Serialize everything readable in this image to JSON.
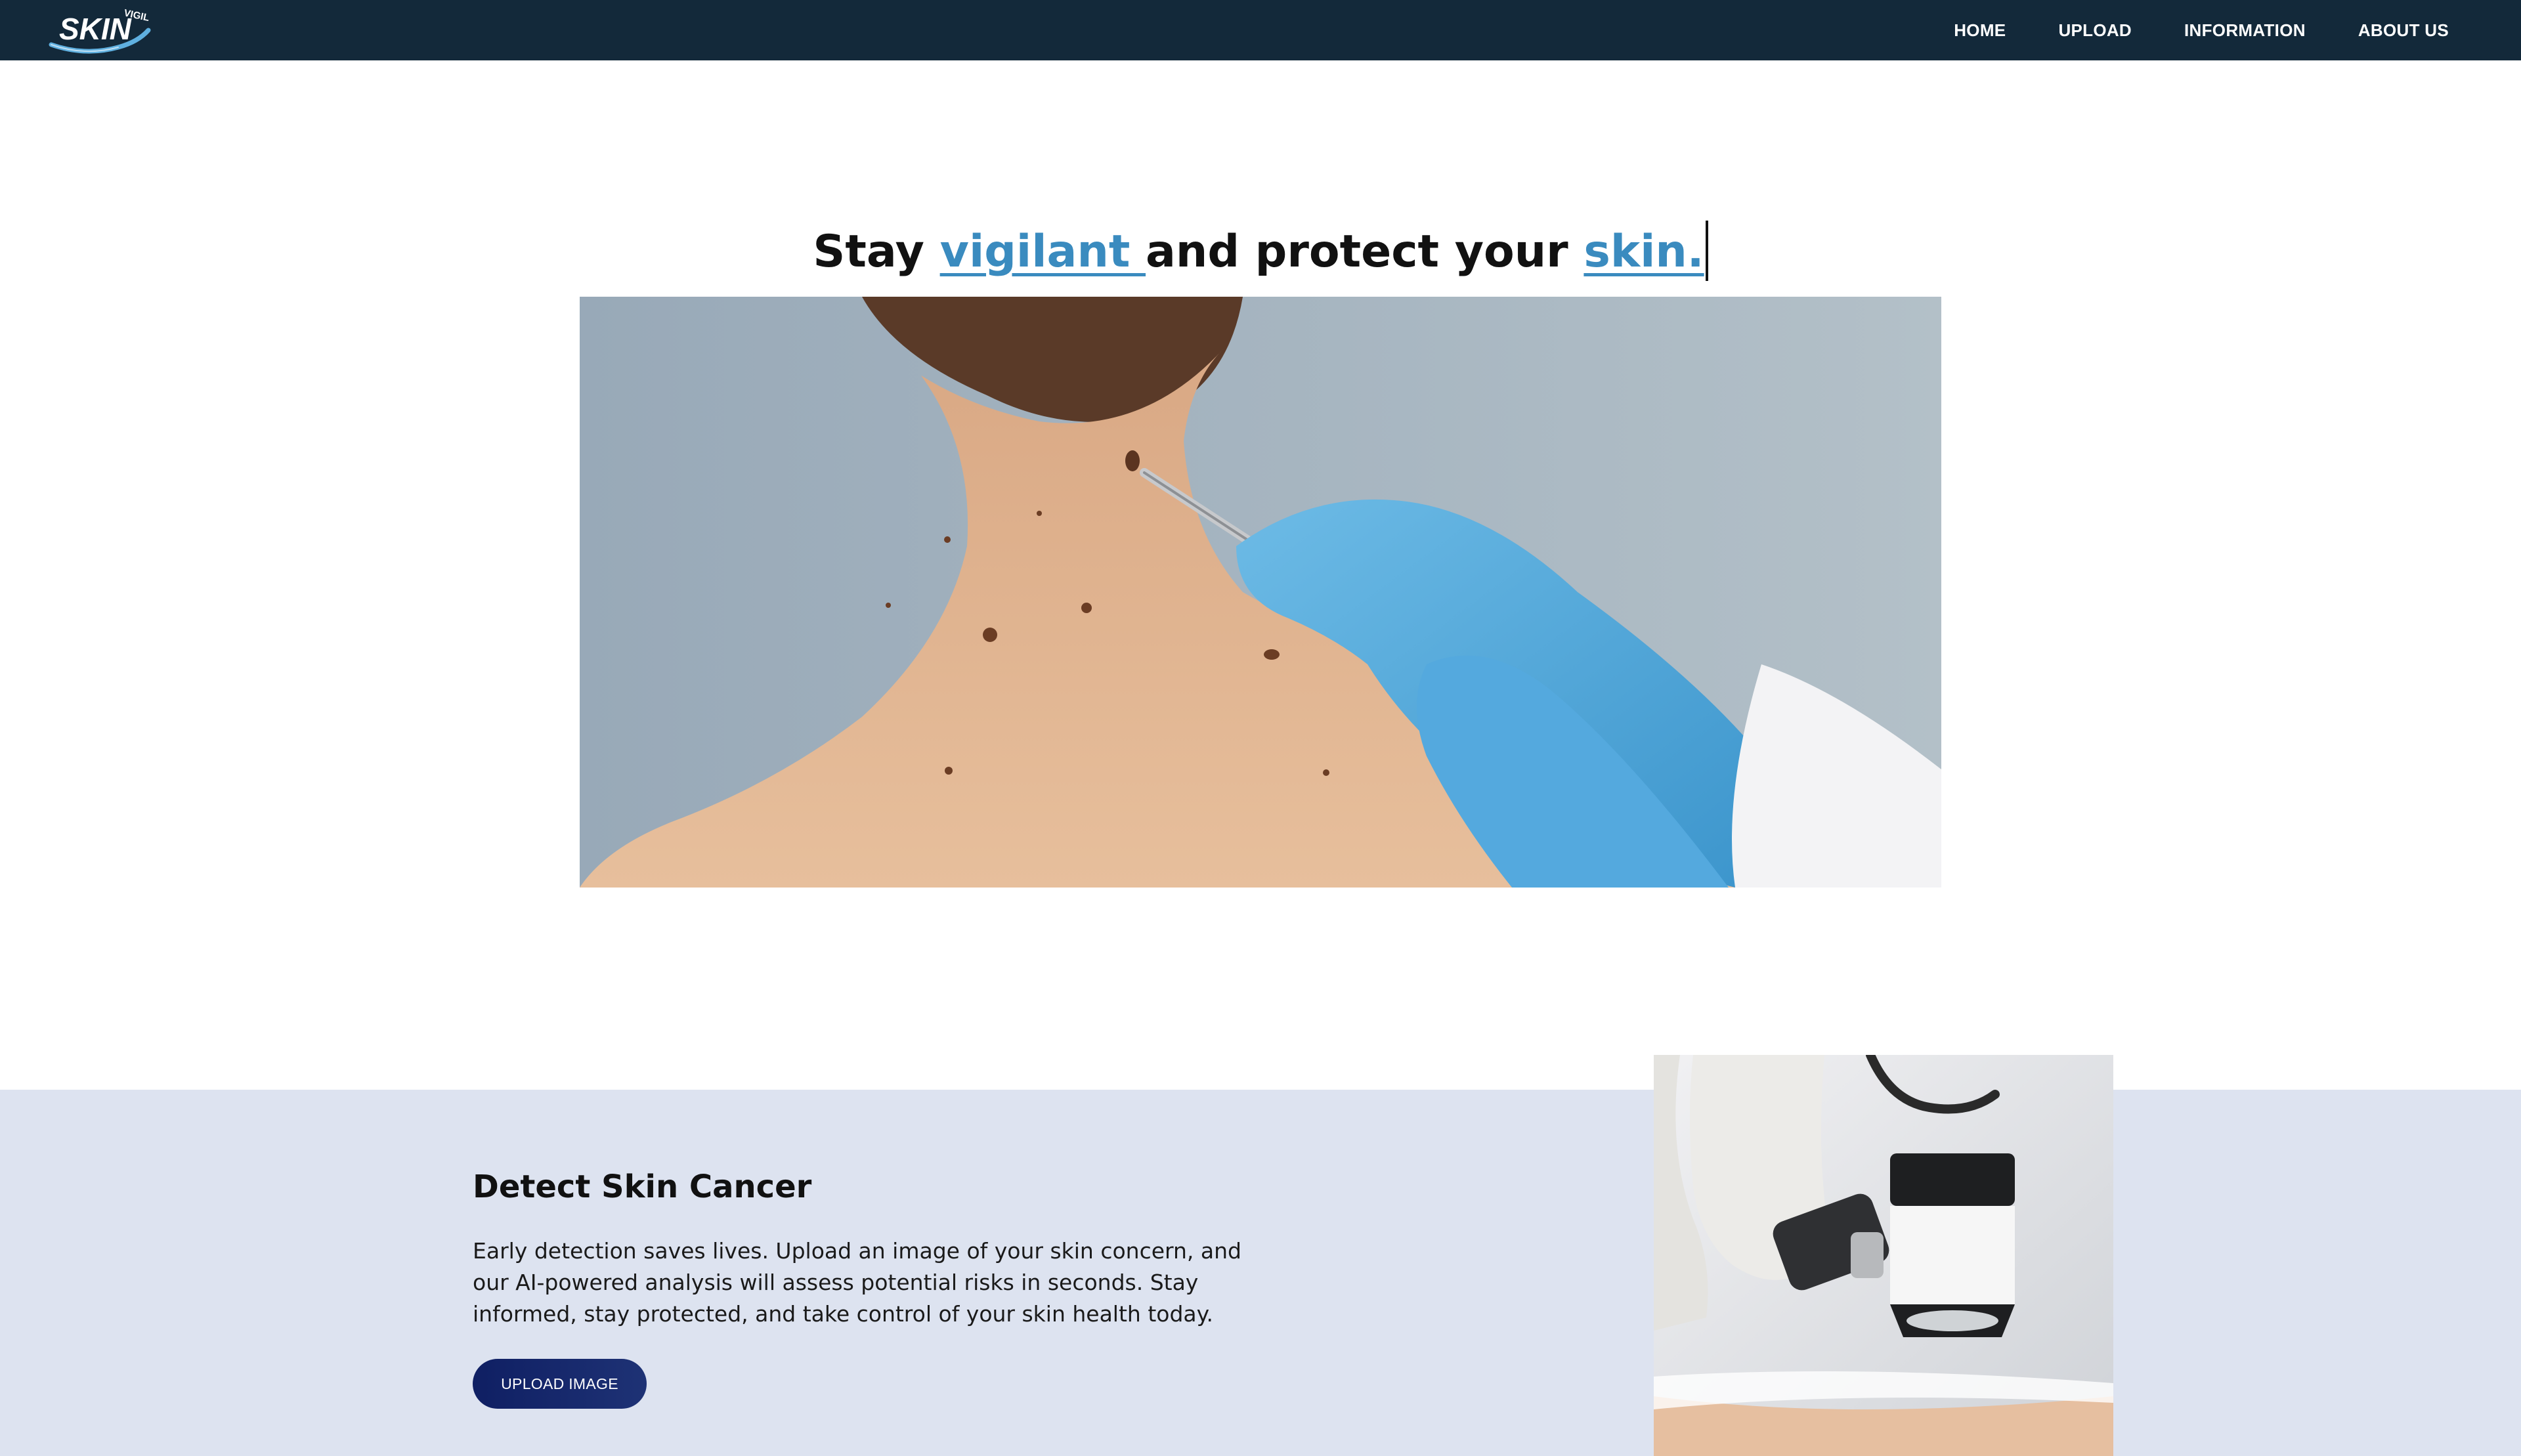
{
  "brand": {
    "logo_text": "SKIN",
    "logo_small_text": "VIGIL"
  },
  "nav": {
    "items": [
      {
        "label": "HOME"
      },
      {
        "label": "UPLOAD"
      },
      {
        "label": "INFORMATION"
      },
      {
        "label": "ABOUT US"
      }
    ]
  },
  "hero": {
    "heading_part1": "Stay ",
    "heading_highlight1": "vigilant ",
    "heading_part2": "and protect your ",
    "heading_highlight2": "skin.",
    "image_icon": "dermatologist-examining-moles-photo"
  },
  "detect": {
    "title": "Detect Skin Cancer",
    "description": "Early detection saves lives. Upload an image of your skin concern, and our AI-powered analysis will assess potential risks in seconds. Stay informed, stay protected, and take control of your skin health today.",
    "button_label": "UPLOAD IMAGE",
    "image_icon": "dermatoscope-exam-photo"
  },
  "colors": {
    "navbar_bg": "#13293a",
    "accent": "#3a8bbf",
    "section_bg": "#dde3f0",
    "button_bg": "#0f1f63"
  }
}
